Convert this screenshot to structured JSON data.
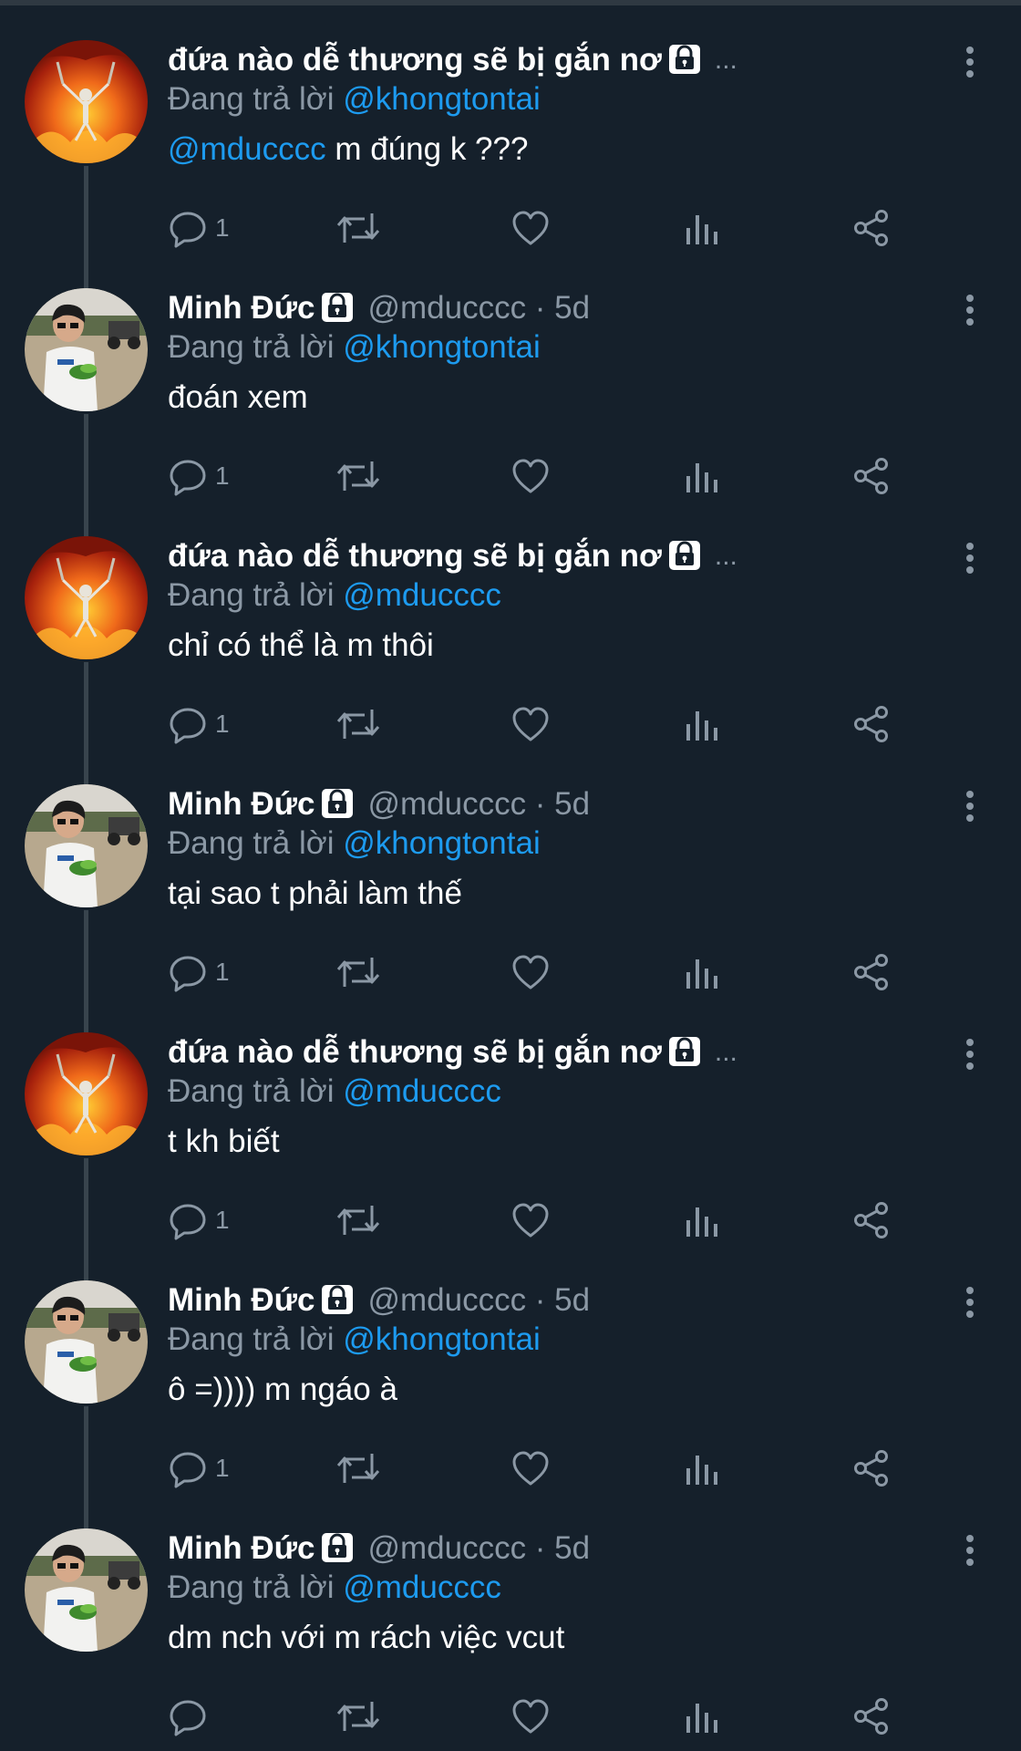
{
  "ui": {
    "reply_prefix": "Đang trả lời",
    "ellipsis": "..."
  },
  "colors": {
    "background": "#15202b",
    "text": "#ffffff",
    "muted": "#8b98a5",
    "mention": "#1d9bf0",
    "thread_line": "#38444d"
  },
  "tweets": [
    {
      "author": "đứa nào dễ thương sẽ bị gắn nơ",
      "avatar": "fire-skeleton",
      "meta": "",
      "truncated": true,
      "reply_to": "@khongtontai",
      "mention": "@mducccc",
      "text": " m đúng k ???",
      "reply_count": "1"
    },
    {
      "author": "Minh Đức",
      "avatar": "boy-photo",
      "meta": "@mducccc · 5d",
      "truncated": false,
      "reply_to": "@khongtontai",
      "mention": "",
      "text": "đoán xem",
      "reply_count": "1"
    },
    {
      "author": "đứa nào dễ thương sẽ bị gắn nơ",
      "avatar": "fire-skeleton",
      "meta": "",
      "truncated": true,
      "reply_to": "@mducccc",
      "mention": "",
      "text": "chỉ có thể là m thôi",
      "reply_count": "1"
    },
    {
      "author": "Minh Đức",
      "avatar": "boy-photo",
      "meta": "@mducccc · 5d",
      "truncated": false,
      "reply_to": "@khongtontai",
      "mention": "",
      "text": "tại sao t phải làm thế",
      "reply_count": "1"
    },
    {
      "author": "đứa nào dễ thương sẽ bị gắn nơ",
      "avatar": "fire-skeleton",
      "meta": "",
      "truncated": true,
      "reply_to": "@mducccc",
      "mention": "",
      "text": "t kh biết",
      "reply_count": "1"
    },
    {
      "author": "Minh Đức",
      "avatar": "boy-photo",
      "meta": "@mducccc · 5d",
      "truncated": false,
      "reply_to": "@khongtontai",
      "mention": "",
      "text": "ô =)))) m ngáo à",
      "reply_count": "1"
    },
    {
      "author": "Minh Đức",
      "avatar": "boy-photo",
      "meta": "@mducccc · 5d",
      "truncated": false,
      "reply_to": "@mducccc",
      "mention": "",
      "text": "dm nch với m rách việc vcut",
      "reply_count": ""
    }
  ]
}
